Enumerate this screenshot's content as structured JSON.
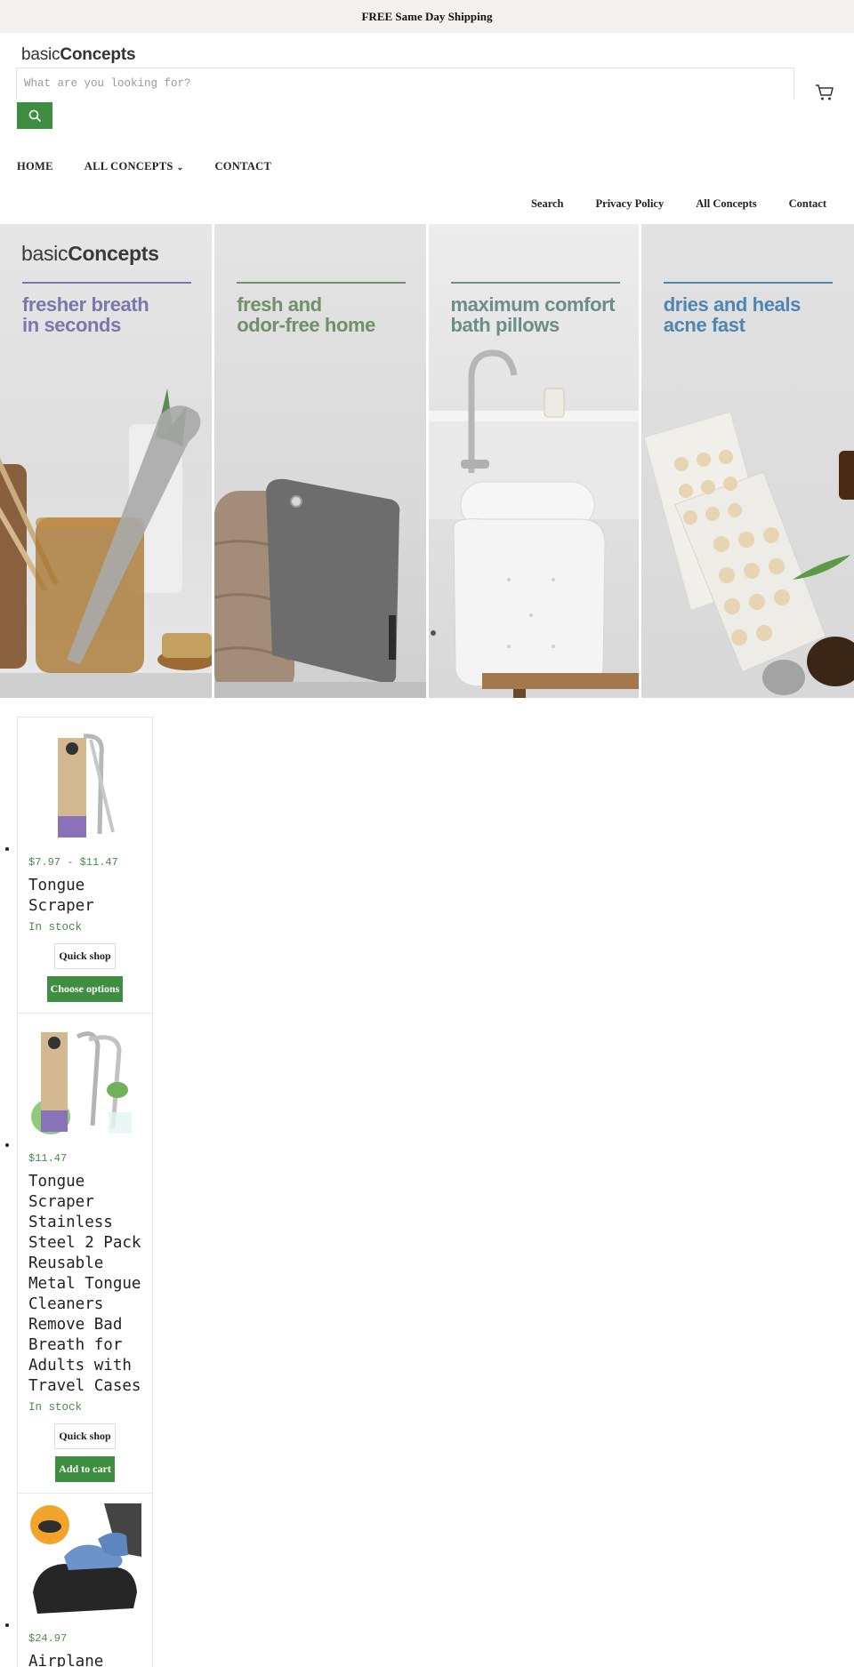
{
  "announcement": "FREE Same Day Shipping",
  "brand": {
    "light": "basic",
    "bold": "Concepts"
  },
  "search": {
    "placeholder": "What are you looking for?",
    "icon": "search-icon"
  },
  "cart": {
    "icon": "cart-icon"
  },
  "main_nav": [
    {
      "label": "HOME"
    },
    {
      "label": "ALL CONCEPTS",
      "icon": "chevron-down-icon"
    },
    {
      "label": "CONTACT"
    }
  ],
  "secondary_nav": [
    "Search",
    "Privacy Policy",
    "All Concepts",
    "Contact"
  ],
  "hero": {
    "panels": [
      {
        "line1": "fresher breath",
        "line2": "in seconds",
        "color": "#7b77ad"
      },
      {
        "line1": "fresh and",
        "line2": "odor-free home",
        "color": "#6f9167"
      },
      {
        "line1": "maximum comfort",
        "line2": "bath pillows",
        "color": "#6c8e88"
      },
      {
        "line1": "dries and heals",
        "line2": "acne fast",
        "color": "#4d86b3"
      }
    ]
  },
  "products": [
    {
      "price": "$7.97 - $11.47",
      "title": "Tongue Scraper",
      "stock": "In stock",
      "quick_shop": "Quick shop",
      "action": "Choose options"
    },
    {
      "price": "$11.47",
      "title": "Tongue Scraper Stainless Steel 2 Pack Reusable Metal Tongue Cleaners Remove Bad Breath for Adults with Travel Cases",
      "stock": "In stock",
      "quick_shop": "Quick shop",
      "action": "Add to cart"
    },
    {
      "price": "$24.97",
      "title": "Airplane"
    }
  ],
  "colors": {
    "accent": "#3e8e41",
    "price": "#4a8a4e",
    "announcement_bg": "#f3f2ee"
  }
}
